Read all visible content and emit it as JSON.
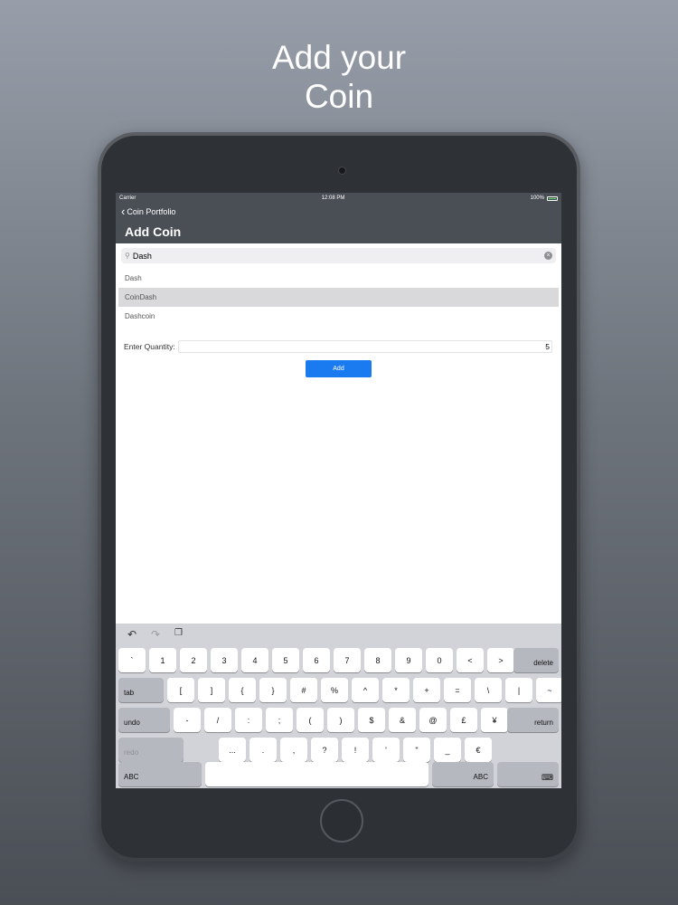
{
  "promo": {
    "line1": "Add your",
    "line2": "Coin"
  },
  "status_bar": {
    "carrier": "Carrier",
    "time": "12:08 PM",
    "battery": "100%"
  },
  "nav": {
    "back_label": "Coin Portfolio",
    "title": "Add Coin"
  },
  "search": {
    "value": "Dash"
  },
  "results": [
    "Dash",
    "CoinDash",
    "Dashcoin"
  ],
  "selected_result": "CoinDash",
  "quantity": {
    "label": "Enter Quantity:",
    "value": "5"
  },
  "add_button": "Add",
  "keyboard": {
    "row1": [
      "`",
      "1",
      "2",
      "3",
      "4",
      "5",
      "6",
      "7",
      "8",
      "9",
      "0",
      "<",
      ">"
    ],
    "delete": "delete",
    "tab": "tab",
    "row2": [
      "[",
      "]",
      "{",
      "}",
      "#",
      "%",
      "^",
      "*",
      "+",
      "=",
      "\\",
      "|",
      "~"
    ],
    "undo": "undo",
    "row3": [
      "-",
      "/",
      ":",
      ";",
      "(",
      ")",
      "$",
      "&",
      "@",
      "£",
      "¥"
    ],
    "return": "return",
    "redo": "redo",
    "row4": [
      "...",
      ".",
      ",",
      "?",
      "!",
      "'",
      "\"",
      "_",
      "€"
    ],
    "abc_left": "ABC",
    "abc_right": "ABC"
  }
}
